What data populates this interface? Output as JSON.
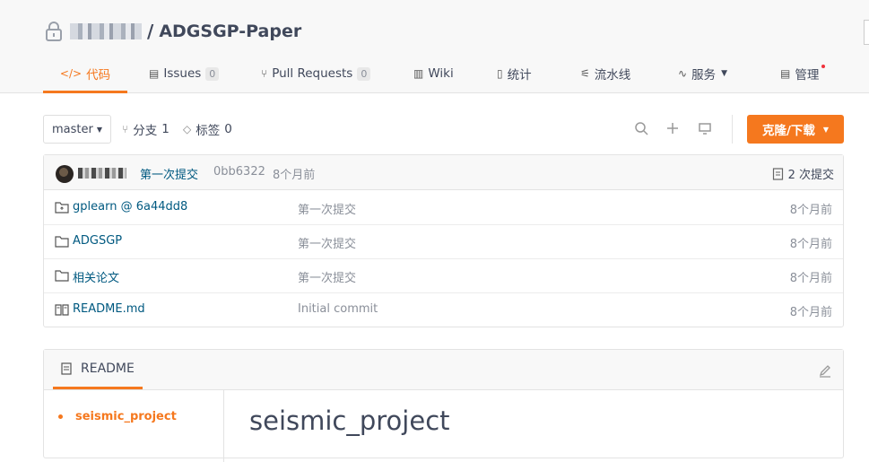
{
  "repo": {
    "name": "ADGSGP-Paper",
    "separator": "/"
  },
  "tabs": [
    {
      "label": "代码",
      "icon": "code-icon"
    },
    {
      "label": "Issues",
      "count": "0",
      "icon": "issues-icon"
    },
    {
      "label": "Pull Requests",
      "count": "0",
      "icon": "pull-request-icon"
    },
    {
      "label": "Wiki",
      "icon": "wiki-icon"
    },
    {
      "label": "统计",
      "icon": "stats-icon"
    },
    {
      "label": "流水线",
      "icon": "pipeline-icon"
    },
    {
      "label": "服务",
      "icon": "service-icon"
    },
    {
      "label": "管理",
      "icon": "manage-icon"
    }
  ],
  "toolbar": {
    "branch": "master",
    "branches_label": "分支",
    "branches_count": "1",
    "tags_label": "标签",
    "tags_count": "0",
    "clone_label": "克隆/下载"
  },
  "commit": {
    "message": "第一次提交",
    "sha": "0bb6322",
    "time": "8个月前",
    "count_label": "2 次提交"
  },
  "files": [
    {
      "name": "gplearn @ 6a44dd8",
      "type": "submodule",
      "message": "第一次提交",
      "time": "8个月前"
    },
    {
      "name": "ADGSGP",
      "type": "folder",
      "message": "第一次提交",
      "time": "8个月前"
    },
    {
      "name": "相关论文",
      "type": "folder",
      "message": "第一次提交",
      "time": "8个月前"
    },
    {
      "name": "README.md",
      "type": "file",
      "message": "Initial commit",
      "time": "8个月前"
    }
  ],
  "readme": {
    "tab_label": "README",
    "toc": [
      "seismic_project"
    ],
    "heading": "seismic_project"
  },
  "colors": {
    "accent": "#f5781e",
    "link": "#005980",
    "muted": "#8a8f99"
  }
}
